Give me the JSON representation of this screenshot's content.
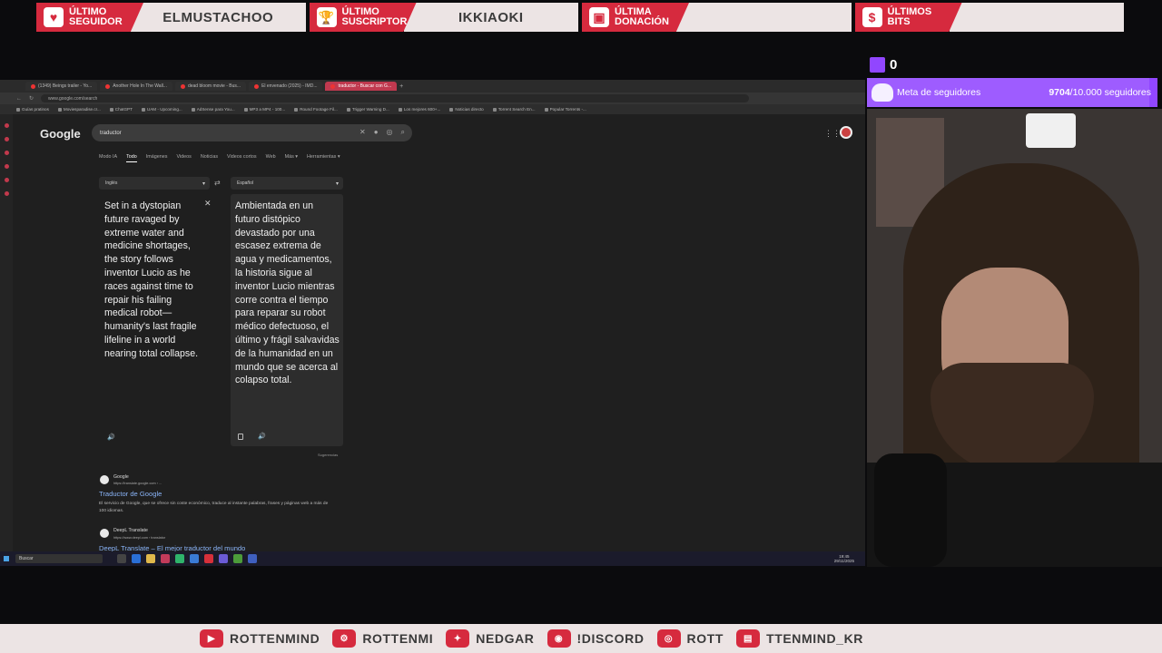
{
  "alerts": [
    {
      "label_1": "Último",
      "label_2": "seguidor",
      "icon": "heart-icon",
      "glyph": "♥",
      "value": "ELMUSTACHOO"
    },
    {
      "label_1": "Último",
      "label_2": "suscriptor",
      "icon": "trophy-icon",
      "glyph": "🏆",
      "value": "IKKIAOKI"
    },
    {
      "label_1": "Última",
      "label_2": "donación",
      "icon": "cash-register-icon",
      "glyph": "▣",
      "value": ""
    },
    {
      "label_1": "Últimos bits",
      "label_2": "",
      "icon": "money-bag-icon",
      "glyph": "$",
      "value": ""
    }
  ],
  "browser": {
    "tabs": [
      {
        "label": "(1349) Beings trailer - Yo...",
        "active": false
      },
      {
        "label": "Another Hole In The Wall...",
        "active": false
      },
      {
        "label": "dead bloom movie - Bus...",
        "active": false
      },
      {
        "label": "El envenado (2025) - IMD...",
        "active": false
      },
      {
        "label": "traductor - Buscar con G...",
        "active": true
      }
    ],
    "new_tab": "+",
    "url": "www.google.com/search",
    "bookmarks": [
      "Guías pratinos",
      "Moviesparadise.cr...",
      "ChatGPT",
      "UAM - Upcoming...",
      "AdSense para You...",
      "MP3 a MP4 - 100...",
      "Round Footage Fil...",
      "Trigger Warning D...",
      "Los mejores 600+...",
      "Noticias directo",
      "Torrent Search En...",
      "Popular Torrents -..."
    ]
  },
  "google": {
    "logo": "Google",
    "query": "traductor",
    "filters": [
      "Modo IA",
      "Todo",
      "Imágenes",
      "Videos",
      "Noticias",
      "Videos cortos",
      "Web",
      "Más ▾",
      "Herramientas ▾"
    ],
    "active_filter": "Todo",
    "source_lang": "Inglés",
    "target_lang": "Español",
    "source_text": "Set in a dystopian future ravaged by extreme water and medicine shortages, the story follows inventor Lucio as he races against time to repair his failing medical robot—humanity's last fragile lifeline in a world nearing total collapse.",
    "target_text": "Ambientada en un futuro distópico devastado por una escasez extrema de agua y medicamentos, la historia sigue al inventor Lucio mientras corre contra el tiempo para reparar su robot médico defectuoso, el último y frágil salvavidas de la humanidad en un mundo que se acerca al colapso total.",
    "feedback": "Sugerencias",
    "results": [
      {
        "site": "Google",
        "url": "https://translate.google.com › ...",
        "title": "Traductor de Google",
        "snippet": "El servicio de Google, que se ofrece sin coste económico, traduce al instante palabras, frases y páginas web a más de 100 idiomas."
      },
      {
        "site": "DeepL Translate",
        "url": "https://www.deepl.com › translator",
        "title": "DeepL Translate – El mejor traductor del mundo",
        "snippet": ""
      }
    ]
  },
  "taskbar": {
    "search": "Buscar",
    "time": "19:45",
    "date": "29/11/2025"
  },
  "stream": {
    "viewer_count": "0",
    "goal_label": "Meta de seguidores",
    "goal_current": "9704",
    "goal_rest": "/10.000 seguidores",
    "goal_progress": 0.9704
  },
  "socials": [
    {
      "icon": "youtube-icon",
      "glyph": "▶",
      "label": "ROTTENMIND"
    },
    {
      "icon": "steam-icon",
      "glyph": "⚙",
      "label": "ROTTENMI"
    },
    {
      "icon": "twitter-icon",
      "glyph": "✦",
      "label": "NEDGAR"
    },
    {
      "icon": "discord-icon",
      "glyph": "◉",
      "label": "!DISCORD"
    },
    {
      "icon": "instagram-icon",
      "glyph": "◎",
      "label": "ROTT"
    },
    {
      "icon": "twitch-icon",
      "glyph": "▤",
      "label": "TTENMIND_KR"
    }
  ],
  "colors": {
    "accent": "#d62a3e",
    "twitch": "#9146ff",
    "link": "#8ab4f8"
  }
}
